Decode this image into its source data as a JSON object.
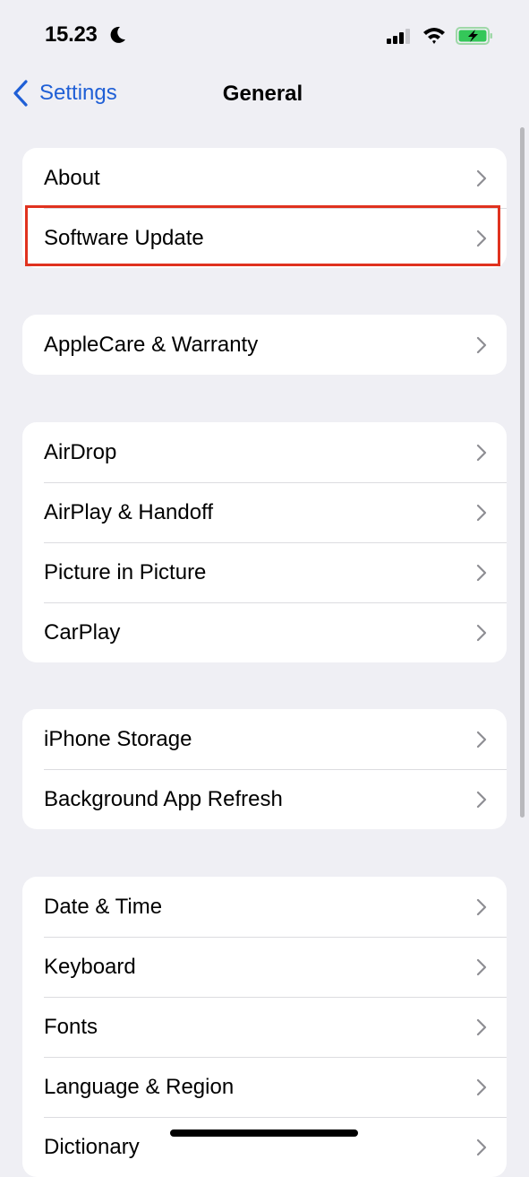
{
  "status_bar": {
    "time": "15.23",
    "icons": [
      "moon-icon",
      "cellular-signal-icon",
      "wifi-icon",
      "battery-charging-icon"
    ],
    "battery_color": "#34c759"
  },
  "nav": {
    "back_label": "Settings",
    "title": "General",
    "accent_color": "#1f5fd6"
  },
  "groups": [
    {
      "items": [
        {
          "label": "About"
        },
        {
          "label": "Software Update",
          "highlighted": true
        }
      ]
    },
    {
      "items": [
        {
          "label": "AppleCare & Warranty"
        }
      ]
    },
    {
      "items": [
        {
          "label": "AirDrop"
        },
        {
          "label": "AirPlay & Handoff"
        },
        {
          "label": "Picture in Picture"
        },
        {
          "label": "CarPlay"
        }
      ]
    },
    {
      "items": [
        {
          "label": "iPhone Storage"
        },
        {
          "label": "Background App Refresh"
        }
      ]
    },
    {
      "items": [
        {
          "label": "Date & Time"
        },
        {
          "label": "Keyboard"
        },
        {
          "label": "Fonts"
        },
        {
          "label": "Language & Region"
        },
        {
          "label": "Dictionary"
        }
      ]
    }
  ],
  "highlight_color": "#e0321f"
}
